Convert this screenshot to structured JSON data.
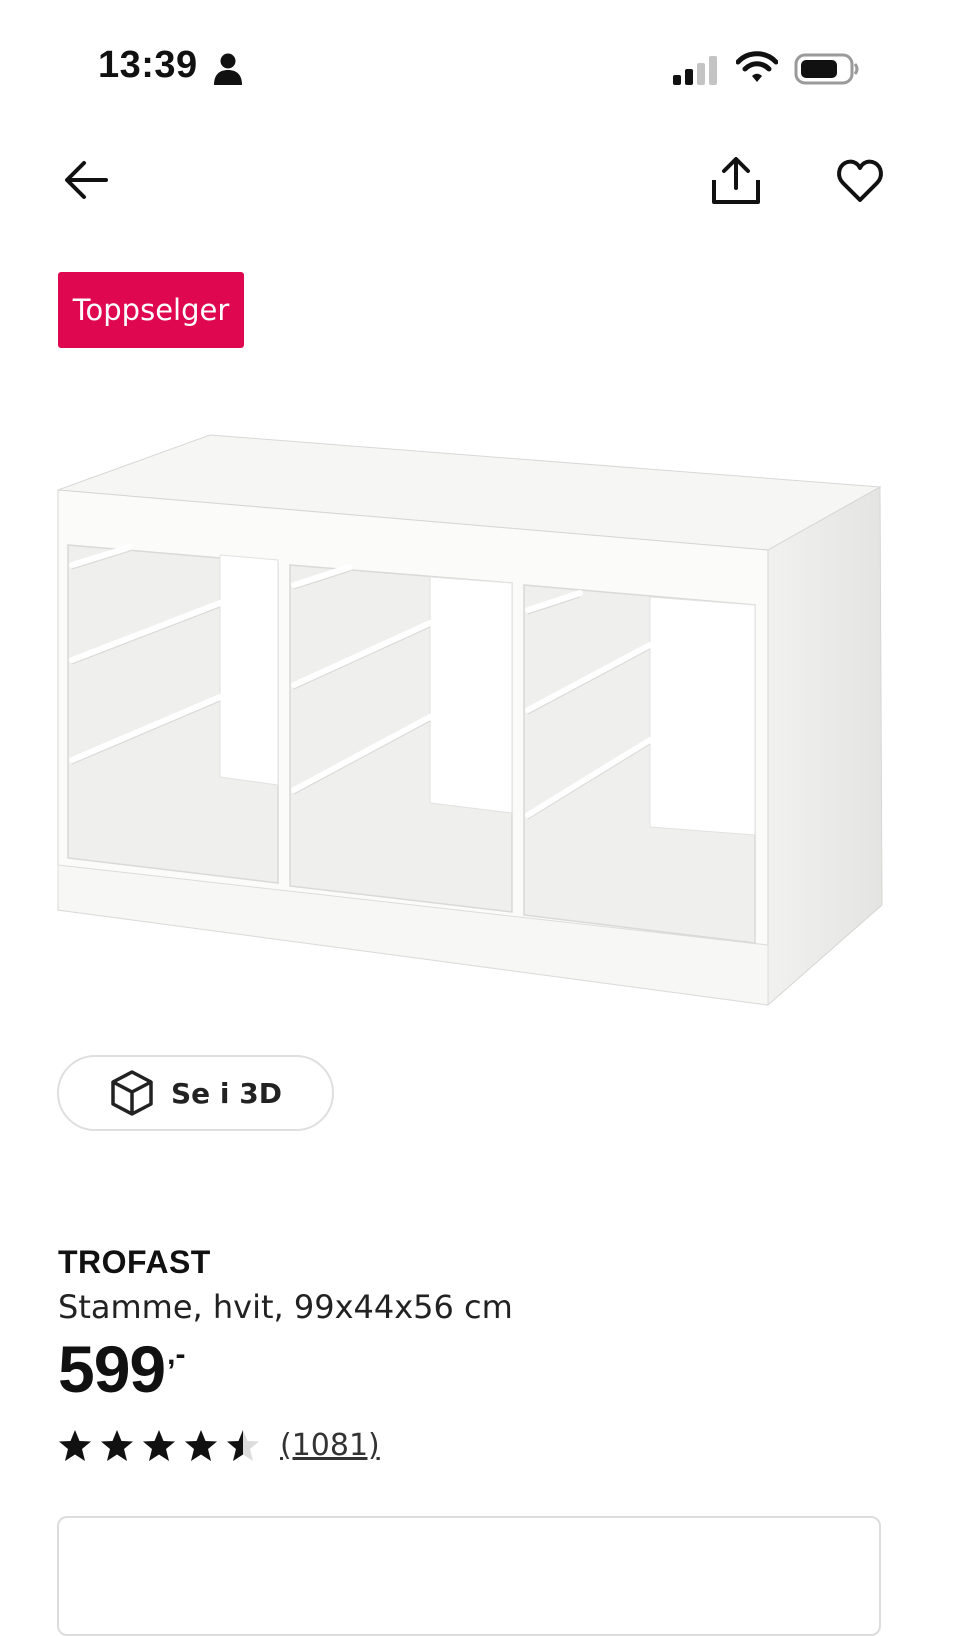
{
  "status_bar": {
    "time": "13:39",
    "person_icon": "person-icon",
    "signal_icon": "cellular-signal-icon",
    "wifi_icon": "wifi-icon",
    "battery_icon": "battery-icon"
  },
  "nav": {
    "back_icon": "arrow-left-icon",
    "share_icon": "share-icon",
    "favorite_icon": "heart-icon"
  },
  "badge": {
    "label": "Toppselger",
    "color": "#e00751"
  },
  "view_3d": {
    "label": "Se i 3D",
    "icon": "cube-3d-icon"
  },
  "product": {
    "name": "TROFAST",
    "description": "Stamme, hvit, 99x44x56 cm",
    "price": "599",
    "price_suffix": ",-",
    "rating": 4.5,
    "rating_max": 5,
    "review_count": "(1081)"
  }
}
